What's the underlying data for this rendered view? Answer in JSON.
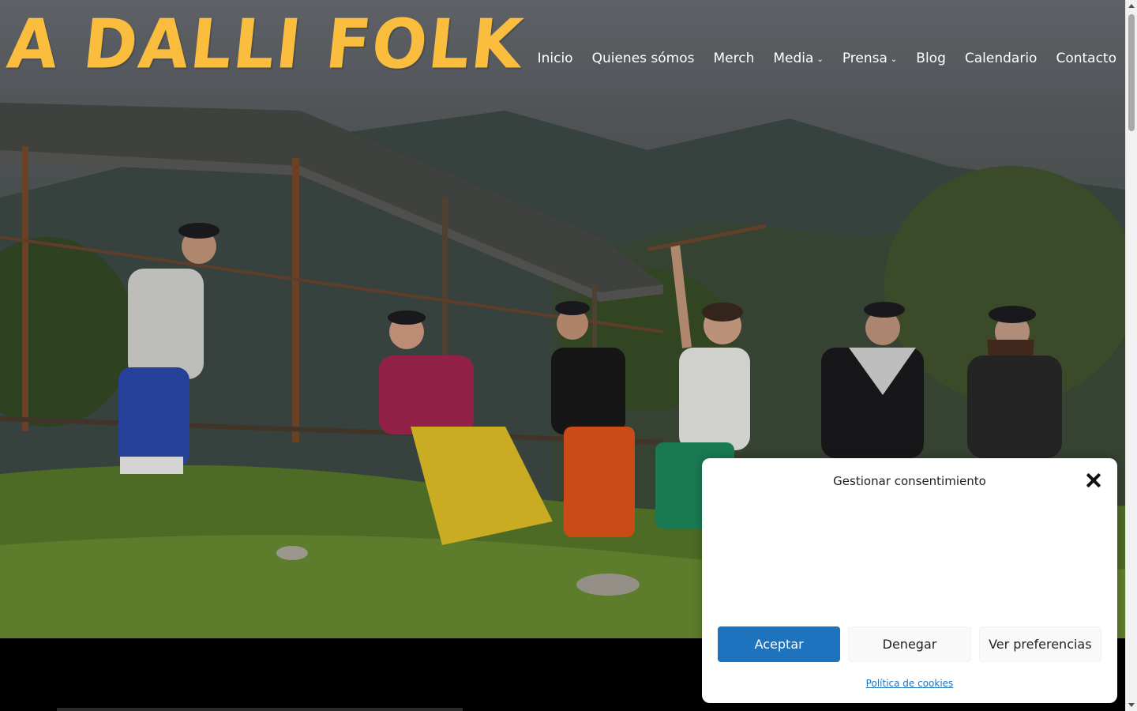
{
  "header": {
    "logo_text": "A DALLI FOLK",
    "logo_color": "#fbbd3e"
  },
  "nav": {
    "items": [
      {
        "label": "Inicio"
      },
      {
        "label": "Quienes sómos"
      },
      {
        "label": "Merch"
      },
      {
        "label": "Media",
        "has_dropdown": true
      },
      {
        "label": "Prensa",
        "has_dropdown": true
      },
      {
        "label": "Blog"
      },
      {
        "label": "Calendario"
      },
      {
        "label": "Contacto"
      }
    ],
    "dropdown_icon": "chevron-down-icon"
  },
  "hero": {
    "image_subject": "band photo outdoors"
  },
  "consent": {
    "title": "Gestionar consentimiento",
    "close_icon": "close-icon",
    "accept_label": "Aceptar",
    "deny_label": "Denegar",
    "preferences_label": "Ver preferencias",
    "cookie_policy_label": "Política de cookies",
    "accent_color": "#1e73be"
  }
}
